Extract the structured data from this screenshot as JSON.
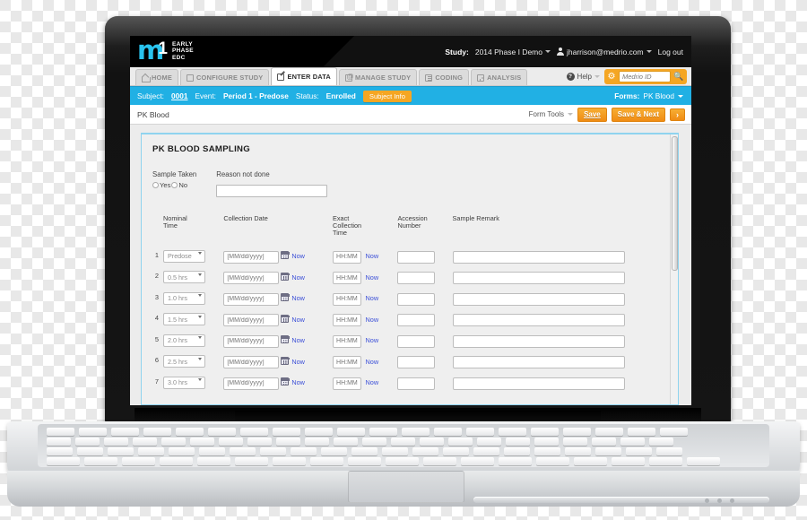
{
  "brand": {
    "logo_mark_m": "m",
    "logo_mark_one": "1",
    "line1": "EARLY",
    "line2": "PHASE",
    "line3": "EDC",
    "accent_cyan": "#29c3ee",
    "accent_orange": "#f5a623",
    "bar_blue": "#21b0e4"
  },
  "topbar": {
    "study_label": "Study:",
    "study_value": "2014 Phase I Demo",
    "user_icon": "user-icon",
    "user_email": "jharrison@medrio.com",
    "logout": "Log out"
  },
  "nav": {
    "tabs": [
      {
        "label": "HOME",
        "icon": "home-icon",
        "active": false
      },
      {
        "label": "CONFIGURE STUDY",
        "icon": "window-icon",
        "active": false
      },
      {
        "label": "ENTER DATA",
        "icon": "pencil-page-icon",
        "active": true
      },
      {
        "label": "MANAGE STUDY",
        "icon": "at-page-icon",
        "active": false
      },
      {
        "label": "CODING",
        "icon": "lines-page-icon",
        "active": false
      },
      {
        "label": "ANALYSIS",
        "icon": "chart-page-icon",
        "active": false
      }
    ],
    "help_label": "Help",
    "gear_icon": "gear-icon",
    "search_placeholder": "Medrio ID",
    "search_value": "",
    "search_icon": "magnifier-icon"
  },
  "subject_bar": {
    "subject_label": "Subject:",
    "subject_value": "0001",
    "event_label": "Event:",
    "event_value": "Period 1 - Predose",
    "status_label": "Status:",
    "status_value": "Enrolled",
    "subject_info_button": "Subject Info",
    "forms_label": "Forms:",
    "forms_value": "PK Blood"
  },
  "form_header": {
    "title": "PK Blood",
    "form_tools": "Form Tools",
    "save": "Save",
    "save_and_next": "Save & Next",
    "next_arrow": "›"
  },
  "form": {
    "panel_title": "PK BLOOD SAMPLING",
    "sample_taken_label": "Sample Taken",
    "radio_yes": "Yes",
    "radio_no": "No",
    "reason_label": "Reason not done",
    "reason_value": "",
    "columns": [
      "Nominal Time",
      "Collection Date",
      "Exact Collection Time",
      "Accession Number",
      "Sample Remark"
    ],
    "date_placeholder": "[MM/dd/yyyy]",
    "time_placeholder": "HH:MM",
    "now_label": "Now",
    "calendar_icon": "calendar-icon",
    "rows": [
      {
        "num": "1",
        "nominal_time": "Predose",
        "collection_date": "",
        "exact_time": "",
        "accession": "",
        "remark": ""
      },
      {
        "num": "2",
        "nominal_time": "0.5 hrs",
        "collection_date": "",
        "exact_time": "",
        "accession": "",
        "remark": ""
      },
      {
        "num": "3",
        "nominal_time": "1.0 hrs",
        "collection_date": "",
        "exact_time": "",
        "accession": "",
        "remark": ""
      },
      {
        "num": "4",
        "nominal_time": "1.5 hrs",
        "collection_date": "",
        "exact_time": "",
        "accession": "",
        "remark": ""
      },
      {
        "num": "5",
        "nominal_time": "2.0 hrs",
        "collection_date": "",
        "exact_time": "",
        "accession": "",
        "remark": ""
      },
      {
        "num": "6",
        "nominal_time": "2.5 hrs",
        "collection_date": "",
        "exact_time": "",
        "accession": "",
        "remark": ""
      },
      {
        "num": "7",
        "nominal_time": "3.0 hrs",
        "collection_date": "",
        "exact_time": "",
        "accession": "",
        "remark": ""
      }
    ]
  }
}
